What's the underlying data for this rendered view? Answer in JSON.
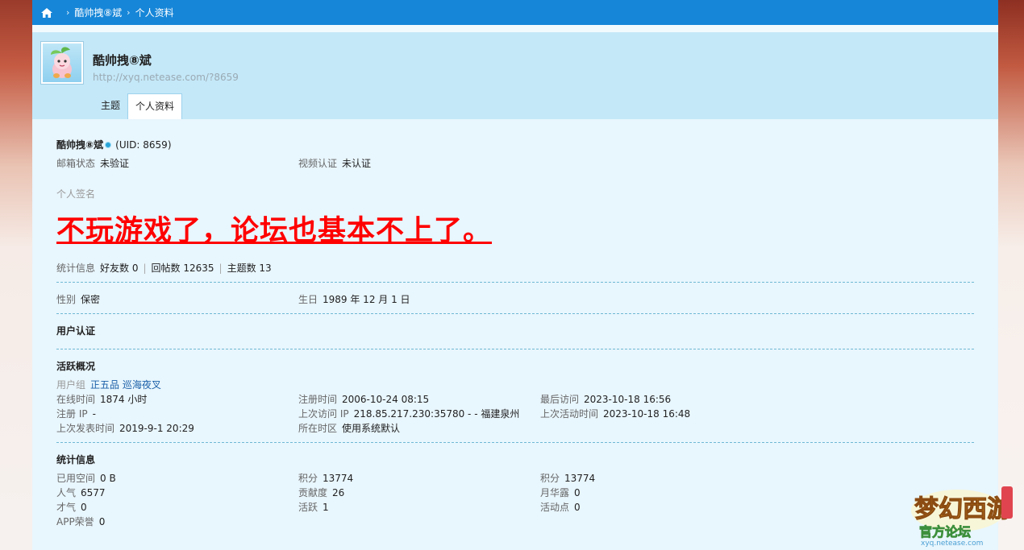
{
  "breadcrumb": {
    "user": "酷帅拽⑧斌",
    "page": "个人资料"
  },
  "header": {
    "username": "酷帅拽⑧斌",
    "url": "http://xyq.netease.com/?8659"
  },
  "tabs": [
    {
      "label": "主题"
    },
    {
      "label": "个人资料"
    }
  ],
  "profile": {
    "name": "酷帅拽⑧斌",
    "uid": "(UID: 8659)",
    "email_label": "邮箱状态",
    "email_value": "未验证",
    "video_label": "视频认证",
    "video_value": "未认证",
    "signature_label": "个人签名",
    "signature": "不玩游戏了，论坛也基本不上了。",
    "stats_label": "统计信息",
    "friends": "好友数 0",
    "replies": "回帖数 12635",
    "threads": "主题数 13",
    "gender_label": "性别",
    "gender_value": "保密",
    "birthday_label": "生日",
    "birthday_value": "1989 年 12 月 1 日"
  },
  "auth": {
    "title": "用户认证"
  },
  "activity": {
    "title": "活跃概况",
    "group_label": "用户组",
    "group_value": "正五品 巡海夜叉",
    "online_label": "在线时间",
    "online_value": "1874 小时",
    "reg_time_label": "注册时间",
    "reg_time_value": "2006-10-24 08:15",
    "last_visit_label": "最后访问",
    "last_visit_value": "2023-10-18 16:56",
    "reg_ip_label": "注册 IP",
    "reg_ip_value": "-",
    "last_ip_label": "上次访问 IP",
    "last_ip_value": "218.85.217.230:35780 - - 福建泉州",
    "last_active_label": "上次活动时间",
    "last_active_value": "2023-10-18 16:48",
    "last_post_label": "上次发表时间",
    "last_post_value": "2019-9-1 20:29",
    "timezone_label": "所在时区",
    "timezone_value": "使用系统默认"
  },
  "statistics": {
    "title": "统计信息",
    "space_label": "已用空间",
    "space_value": "0 B",
    "points_label": "积分",
    "points_value": "13774",
    "points2_label": "积分",
    "points2_value": "13774",
    "popularity_label": "人气",
    "popularity_value": "6577",
    "contrib_label": "贡献度",
    "contrib_value": "26",
    "dew_label": "月华露",
    "dew_value": "0",
    "talent_label": "才气",
    "talent_value": "0",
    "active_label": "活跃",
    "active_value": "1",
    "activity_pts_label": "活动点",
    "activity_pts_value": "0",
    "app_label": "APP荣誉",
    "app_value": "0"
  },
  "colors": {
    "topbar": "#1686d8",
    "signature": "#ff0000",
    "link": "#1a5fa8"
  }
}
